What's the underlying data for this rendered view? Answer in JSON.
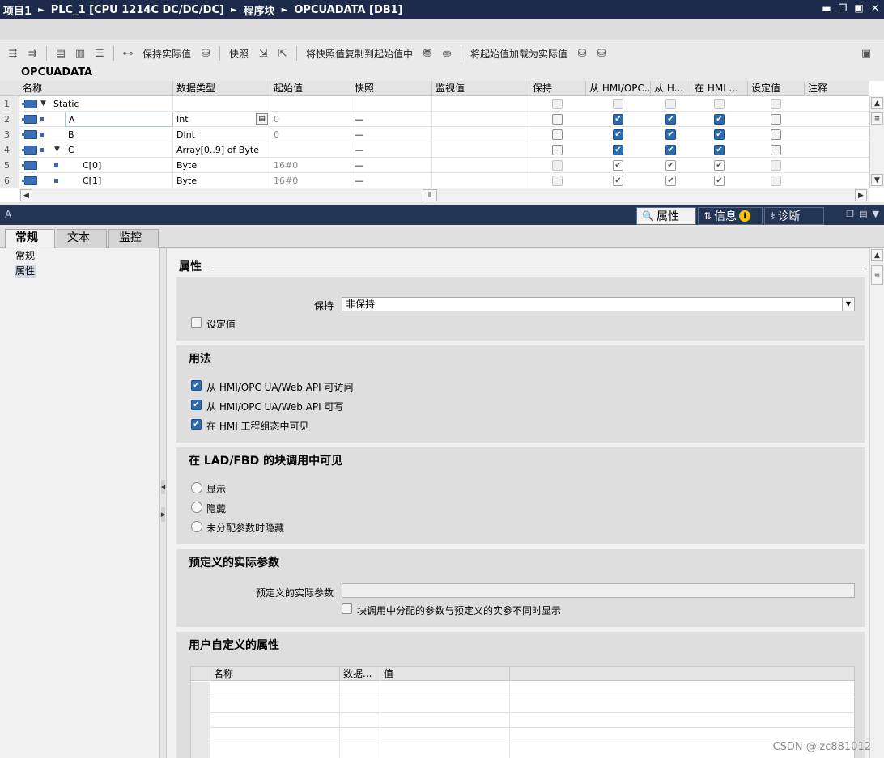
{
  "titlebar": {
    "crumbs": [
      "项目1",
      "PLC_1 [CPU 1214C DC/DC/DC]",
      "程序块",
      "OPCUADATA [DB1]"
    ]
  },
  "toolbar": {
    "keep_actual": "保持实际值",
    "snapshot": "快照",
    "copy_snapshot": "将快照值复制到起始值中",
    "load_start": "将起始值加载为实际值"
  },
  "block_name": "OPCUADATA",
  "table": {
    "headers": [
      "名称",
      "数据类型",
      "起始值",
      "快照",
      "监视值",
      "保持",
      "从 HMI/OPC..",
      "从 H...",
      "在 HMI ...",
      "设定值",
      "注释"
    ],
    "rows": [
      {
        "num": "1",
        "name": "Static",
        "type": "",
        "start": "",
        "snapshot": "",
        "level": 0,
        "expand": "▼",
        "retain": "dis",
        "hmi_access": "dis",
        "hmi_write": "dis",
        "hmi_visible": "dis",
        "setpoint": "dis"
      },
      {
        "num": "2",
        "name": "A",
        "type": "Int",
        "start": "0",
        "snapshot": "—",
        "level": 1,
        "expand": "",
        "retain": "off",
        "hmi_access": "on",
        "hmi_write": "on",
        "hmi_visible": "on",
        "setpoint": "off"
      },
      {
        "num": "3",
        "name": "B",
        "type": "DInt",
        "start": "0",
        "snapshot": "—",
        "level": 1,
        "expand": "",
        "retain": "off",
        "hmi_access": "on",
        "hmi_write": "on",
        "hmi_visible": "on",
        "setpoint": "off"
      },
      {
        "num": "4",
        "name": "C",
        "type": "Array[0..9] of Byte",
        "start": "",
        "snapshot": "—",
        "level": 1,
        "expand": "▼",
        "retain": "off",
        "hmi_access": "on",
        "hmi_write": "on",
        "hmi_visible": "on",
        "setpoint": "off"
      },
      {
        "num": "5",
        "name": "C[0]",
        "type": "Byte",
        "start": "16#0",
        "snapshot": "—",
        "level": 2,
        "expand": "",
        "retain": "dis",
        "hmi_access": "grey",
        "hmi_write": "grey",
        "hmi_visible": "grey",
        "setpoint": "dis"
      },
      {
        "num": "6",
        "name": "C[1]",
        "type": "Byte",
        "start": "16#0",
        "snapshot": "—",
        "level": 2,
        "expand": "",
        "retain": "dis",
        "hmi_access": "grey",
        "hmi_write": "grey",
        "hmi_visible": "grey",
        "setpoint": "dis"
      }
    ]
  },
  "inspector": {
    "title": "A",
    "tabs": [
      "属性",
      "信息",
      "诊断"
    ],
    "subtabs": [
      "常规",
      "文本",
      "监控"
    ]
  },
  "nav": {
    "items": [
      "常规",
      "属性"
    ]
  },
  "props": {
    "heading": "属性",
    "retain_label": "保持",
    "retain_value": "非保持",
    "setpoint_label": "设定值",
    "usage_title": "用法",
    "usage_options": [
      "从 HMI/OPC UA/Web API 可访问",
      "从 HMI/OPC UA/Web API 可写",
      "在 HMI 工程组态中可见"
    ],
    "lad_title": "在 LAD/FBD 的块调用中可见",
    "lad_options": [
      "显示",
      "隐藏",
      "未分配参数时隐藏"
    ],
    "predef_title": "预定义的实际参数",
    "predef_label": "预定义的实际参数",
    "predef_check": "块调用中分配的参数与预定义的实参不同时显示",
    "user_title": "用户自定义的属性",
    "user_headers": [
      "名称",
      "数据...",
      "值"
    ]
  },
  "watermark": "CSDN @lzc881012"
}
